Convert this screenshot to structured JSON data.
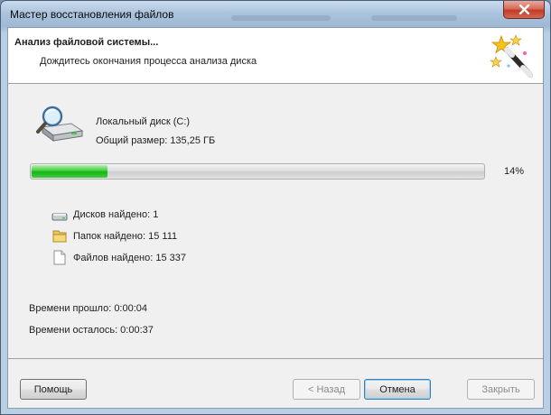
{
  "window": {
    "title": "Мастер восстановления файлов"
  },
  "header": {
    "title": "Анализ файловой системы...",
    "subtitle": "Дождитесь окончания процесса анализа диска"
  },
  "disk": {
    "name": "Локальный диск (C:)",
    "size": "Общий размер: 135,25 ГБ"
  },
  "progress": {
    "value": 14,
    "label": "14%"
  },
  "stats": {
    "disks": "Дисков найдено: 1",
    "folders": "Папок найдено: 15 111",
    "files": "Файлов найдено: 15 337"
  },
  "time": {
    "elapsed": "Времени прошло: 0:00:04",
    "remaining": "Времени осталось: 0:00:37"
  },
  "buttons": {
    "help": "Помощь",
    "back": "< Назад",
    "cancel": "Отмена",
    "close": "Закрыть"
  },
  "colors": {
    "progress": "#17b417",
    "close_button": "#c03b27"
  }
}
